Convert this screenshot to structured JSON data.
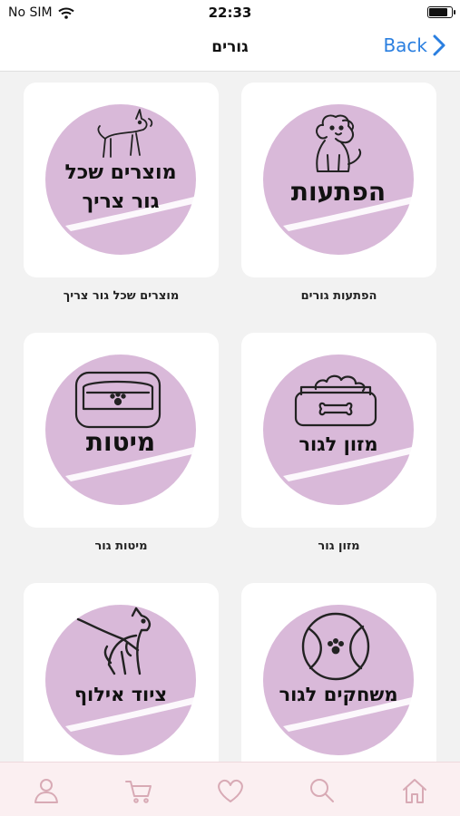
{
  "status": {
    "carrier": "No SIM",
    "time": "22:33",
    "battery_level": 0.85
  },
  "nav": {
    "title": "גורים",
    "back_label": "Back"
  },
  "cards": [
    {
      "badge_lines": [
        "הפתעות"
      ],
      "caption": "הפתעות גורים",
      "icon": "sitting-dog-icon"
    },
    {
      "badge_lines": [
        "מוצרים שכל",
        "גור צריך"
      ],
      "caption": "מוצרים שכל גור צריך",
      "icon": "puppy-icon"
    },
    {
      "badge_lines": [
        "מזון לגור"
      ],
      "caption": "מזון גור",
      "icon": "food-bowl-icon"
    },
    {
      "badge_lines": [
        "מיטות"
      ],
      "caption": "מיטות גור",
      "icon": "dog-bed-icon"
    },
    {
      "badge_lines": [
        "משחקים לגור"
      ],
      "caption": "",
      "icon": "ball-icon"
    },
    {
      "badge_lines": [
        "ציוד אילוף"
      ],
      "caption": "",
      "icon": "dog-harness-icon"
    }
  ],
  "tabs": [
    "home-icon",
    "search-icon",
    "heart-icon",
    "cart-icon",
    "profile-icon"
  ],
  "colors": {
    "badge": "#d9b9d9",
    "accent": "#2a7fe0",
    "tab_bar": "#fbeff1",
    "tab_icon": "#d8aab5"
  }
}
